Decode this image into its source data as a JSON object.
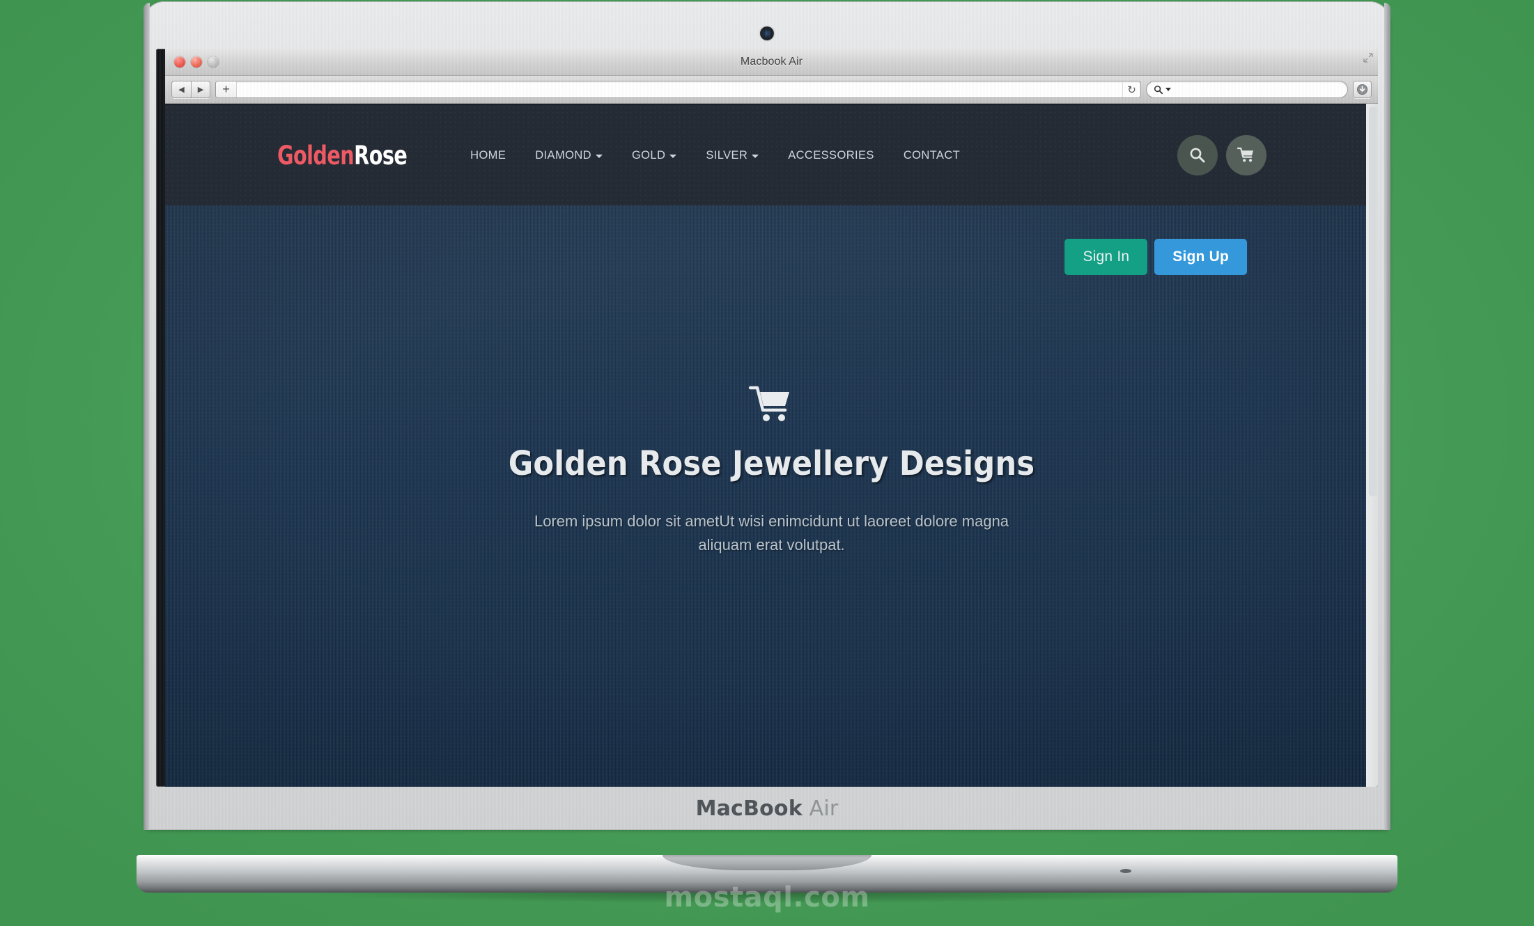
{
  "os_window": {
    "title": "Macbook Air",
    "traffic_lights": [
      "close",
      "minimize",
      "zoom"
    ],
    "resize_grip_icon": "resize-grip-icon"
  },
  "browser_toolbar": {
    "back_label": "◀",
    "forward_label": "▶",
    "new_tab_label": "+",
    "url_value": "",
    "url_placeholder": "",
    "reload_icon": "reload-icon",
    "search_value": "",
    "search_placeholder": "",
    "search_icon": "search-icon",
    "search_caret_icon": "chevron-down-icon",
    "downloads_icon": "downloads-icon"
  },
  "site": {
    "logo": {
      "first": "Golden",
      "second": "Rose",
      "first_color": "#ee5a63",
      "second_color": "#ffffff"
    },
    "nav": [
      {
        "label": "HOME",
        "has_dropdown": false
      },
      {
        "label": "DIAMOND",
        "has_dropdown": true
      },
      {
        "label": "GOLD",
        "has_dropdown": true
      },
      {
        "label": "SILVER",
        "has_dropdown": true
      },
      {
        "label": "ACCESSORIES",
        "has_dropdown": false
      },
      {
        "label": "CONTACT",
        "has_dropdown": false
      }
    ],
    "header_actions": [
      {
        "name": "search-icon",
        "label": "Search"
      },
      {
        "name": "cart-icon",
        "label": "Cart"
      }
    ],
    "auth": {
      "sign_in_label": "Sign In",
      "sign_in_color": "#14a085",
      "sign_up_label": "Sign Up",
      "sign_up_color": "#3498db"
    },
    "hero": {
      "icon": "shopping-cart-icon",
      "title": "Golden Rose Jewellery Designs",
      "subtitle": "Lorem ipsum dolor sit ametUt wisi enimcidunt ut laoreet dolore magna aliquam erat volutpat."
    },
    "header_bg": "#242b35"
  },
  "hardware": {
    "chin_label_bold": "MacBook",
    "chin_label_light": "Air"
  },
  "watermark": "mostaql.com"
}
